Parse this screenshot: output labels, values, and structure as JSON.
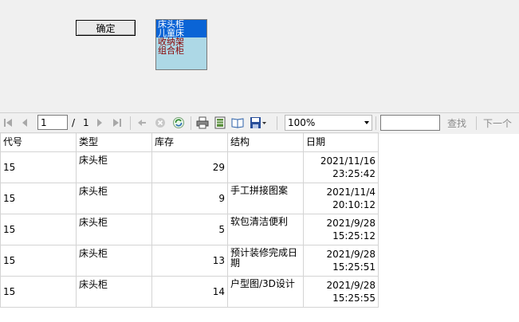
{
  "form": {
    "ok_label": "确定",
    "list_items": [
      "床头柜",
      "儿童床",
      "收纳架",
      "组合柜"
    ],
    "selected_items": [
      0,
      1
    ]
  },
  "toolbar": {
    "current_page": "1",
    "page_separator": "/",
    "total_pages": "1",
    "zoom": "100%",
    "search_value": "",
    "find_label": "查找",
    "next_label": "下一个",
    "icons": [
      "first-page-icon",
      "previous-page-icon",
      "next-page-icon",
      "last-page-icon",
      "back-icon",
      "stop-icon",
      "refresh-icon",
      "print-icon",
      "print-layout-icon",
      "page-setup-icon",
      "export-icon"
    ]
  },
  "table": {
    "columns": [
      "代号",
      "类型",
      "库存",
      "结构",
      "日期"
    ],
    "rows": [
      {
        "code": "15",
        "type": "床头柜",
        "stock": "29",
        "structure": "",
        "date": "2021/11/16",
        "time": "23:25:42"
      },
      {
        "code": "15",
        "type": "床头柜",
        "stock": "9",
        "structure": "手工拼接图案",
        "date": "2021/11/4",
        "time": "20:10:12"
      },
      {
        "code": "15",
        "type": "床头柜",
        "stock": "5",
        "structure": "软包清洁便利",
        "date": "2021/9/28",
        "time": "15:25:12"
      },
      {
        "code": "15",
        "type": "床头柜",
        "stock": "13",
        "structure": "预计装修完成日期",
        "date": "2021/9/28",
        "time": "15:25:51"
      },
      {
        "code": "15",
        "type": "床头柜",
        "stock": "14",
        "structure": "户型图/3D设计",
        "date": "2021/9/28",
        "time": "15:25:55"
      }
    ]
  }
}
